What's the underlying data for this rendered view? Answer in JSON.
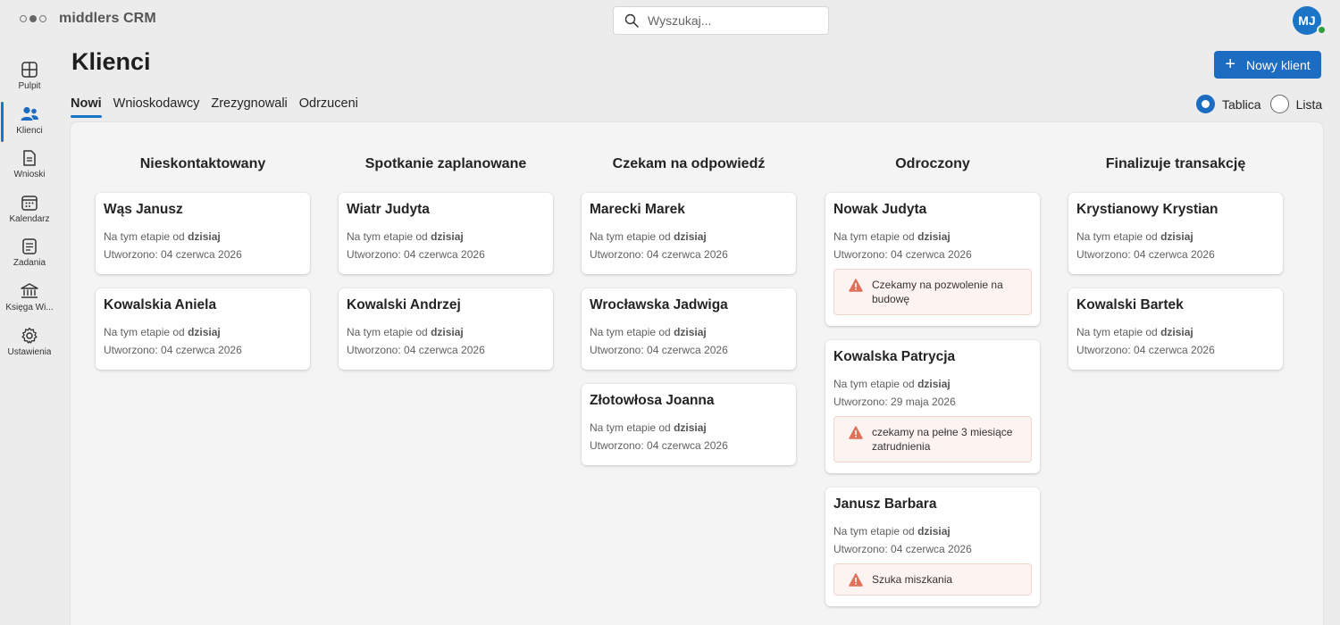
{
  "app": {
    "title": "middlers CRM",
    "user_initials": "MJ"
  },
  "search": {
    "placeholder": "Wyszukaj..."
  },
  "sidebar": {
    "items": [
      {
        "label": "Pulpit",
        "icon": "dashboard-icon"
      },
      {
        "label": "Klienci",
        "icon": "people-icon"
      },
      {
        "label": "Wnioski",
        "icon": "document-icon"
      },
      {
        "label": "Kalendarz",
        "icon": "calendar-icon"
      },
      {
        "label": "Zadania",
        "icon": "tasks-icon"
      },
      {
        "label": "Księga Wi...",
        "icon": "bank-icon"
      },
      {
        "label": "Ustawienia",
        "icon": "gear-icon"
      }
    ]
  },
  "page": {
    "title": "Klienci",
    "new_button": "Nowy klient"
  },
  "tabs": [
    "Nowi",
    "Wnioskodawcy",
    "Zrezygnowali",
    "Odrzuceni"
  ],
  "view": {
    "board": "Tablica",
    "list": "Lista"
  },
  "stage_prefix": "Na tym etapie od",
  "columns": [
    {
      "title": "Nieskontaktowany",
      "cards": [
        {
          "name": "Wąs Janusz",
          "since": "dzisiaj",
          "created": "Utworzono: 04 czerwca 2026"
        },
        {
          "name": "Kowalskia Aniela",
          "since": "dzisiaj",
          "created": "Utworzono: 04 czerwca 2026"
        }
      ]
    },
    {
      "title": "Spotkanie zaplanowane",
      "cards": [
        {
          "name": "Wiatr Judyta",
          "since": "dzisiaj",
          "created": "Utworzono: 04 czerwca 2026"
        },
        {
          "name": "Kowalski Andrzej",
          "since": "dzisiaj",
          "created": "Utworzono: 04 czerwca 2026"
        }
      ]
    },
    {
      "title": "Czekam na odpowiedź",
      "cards": [
        {
          "name": "Marecki Marek",
          "since": "dzisiaj",
          "created": "Utworzono: 04 czerwca 2026"
        },
        {
          "name": "Wrocławska Jadwiga",
          "since": "dzisiaj",
          "created": "Utworzono: 04 czerwca 2026"
        },
        {
          "name": "Złotowłosa Joanna",
          "since": "dzisiaj",
          "created": "Utworzono: 04 czerwca 2026"
        }
      ]
    },
    {
      "title": "Odroczony",
      "cards": [
        {
          "name": "Nowak Judyta",
          "since": "dzisiaj",
          "created": "Utworzono: 04 czerwca 2026",
          "note": "Czekamy na pozwolenie na budowę"
        },
        {
          "name": "Kowalska Patrycja",
          "since": "dzisiaj",
          "created": "Utworzono: 29 maja 2026",
          "note": "czekamy na pełne 3 miesiące zatrudnienia"
        },
        {
          "name": "Janusz Barbara",
          "since": "dzisiaj",
          "created": "Utworzono: 04 czerwca 2026",
          "note": "Szuka miszkania"
        }
      ]
    },
    {
      "title": "Finalizuje transakcję",
      "cards": [
        {
          "name": "Krystianowy Krystian",
          "since": "dzisiaj",
          "created": "Utworzono: 04 czerwca 2026"
        },
        {
          "name": "Kowalski Bartek",
          "since": "dzisiaj",
          "created": "Utworzono: 04 czerwca 2026"
        }
      ]
    }
  ],
  "colors": {
    "accent": "#1c6cc2",
    "warning": "#e0705a",
    "note_bg": "#fdf3f0"
  }
}
